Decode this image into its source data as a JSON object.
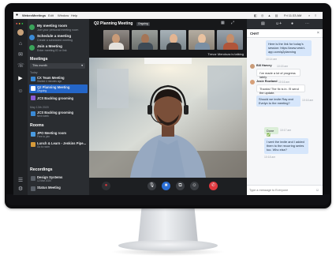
{
  "menubar": {
    "items": [
      "WebexMeetings",
      "Edit",
      "Window",
      "Help"
    ],
    "clock": "Fri 11:33 AM"
  },
  "sidebar": {
    "actions": [
      {
        "title": "My meeting room",
        "subtitle": "Join your personal meeting room"
      },
      {
        "title": "Schedule a meeting",
        "subtitle": "Create a scheduled meeting"
      },
      {
        "title": "Join a Meeting",
        "subtitle": "Enter meeting ID or link"
      }
    ],
    "meetings_heading": "Meetings",
    "filter": "This month",
    "today_label": "Today",
    "meetings": [
      {
        "title": "CX Team Meeting",
        "subtitle": "Started 4 minutes ago",
        "color": "#3a8ad6"
      },
      {
        "title": "Q2 Planning Meeting",
        "subtitle": "Ongoing",
        "color": "#ffffff",
        "active": true
      },
      {
        "title": "JCS Backlog grooming",
        "subtitle": "",
        "color": "#8a5ad6"
      }
    ],
    "next_label": "May 13th 2020",
    "later": [
      {
        "title": "JCS Backlog grooming",
        "subtitle": "Next week",
        "color": "#3a8ad6"
      }
    ],
    "rooms_heading": "Rooms",
    "rooms": [
      {
        "title": "JPO Meeting room",
        "subtitle": "Free to join",
        "color": "#4a9be0"
      },
      {
        "title": "Lunch & Learn - Jenkins Pipe...",
        "subtitle": "Go to room",
        "color": "#d69a3a"
      }
    ],
    "recordings_heading": "Recordings",
    "recordings": [
      {
        "title": "Design Systems",
        "subtitle": "12 Mar 2020",
        "color": "#5a6068"
      },
      {
        "title": "Status Meeting",
        "subtitle": "",
        "color": "#5a6068"
      }
    ]
  },
  "meeting": {
    "title": "Q2 Planning Meeting",
    "badge": "Ongoing",
    "talking": "Trevor Mendoza is talking"
  },
  "chat": {
    "title": "CHAT",
    "messages": [
      {
        "kind": "out",
        "text": "Here is the link for today's session: https://www.vestri-app.com/q2planning",
        "time": "10:14 am"
      },
      {
        "kind": "in",
        "sender": "Bill Harvey",
        "time": "10:15 am",
        "text": "I've made a lot of progress lately."
      },
      {
        "kind": "in",
        "sender": "Josie Rowland",
        "time": "10:16 am",
        "text": "Thanks! The fix is in. I'll send the update."
      },
      {
        "kind": "out",
        "text": "Should we invite Ray and Evelyn to the meeting?",
        "time": "10:16 am"
      },
      {
        "kind": "in",
        "sender": "",
        "time": "10:17 am",
        "text": "Done ✅"
      },
      {
        "kind": "out",
        "text": "I sent the invite and I added them to the recurring series too. Who else?",
        "time": "10:18 am"
      }
    ],
    "input_placeholder": "Type a message to Everyone"
  },
  "colors": {
    "accent": "#2b6fd6",
    "end_call": "#e0383e",
    "active_row": "#2466c8"
  },
  "icons": {
    "controls": [
      "mute-icon",
      "video-icon",
      "share-icon",
      "participants-icon",
      "end-call-icon"
    ]
  }
}
